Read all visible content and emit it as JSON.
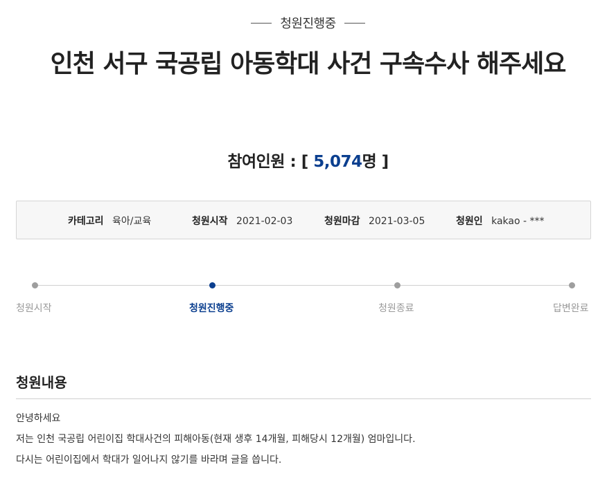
{
  "status": {
    "text": "청원진행중"
  },
  "petition": {
    "title": "인천 서구 국공립 아동학대 사건 구속수사 해주세요"
  },
  "participants": {
    "label": "참여인원 :",
    "open_bracket": "[",
    "count": "5,074",
    "unit": "명",
    "close_bracket": "]"
  },
  "info": {
    "category": {
      "label": "카테고리",
      "value": "육아/교육"
    },
    "start": {
      "label": "청원시작",
      "value": "2021-02-03"
    },
    "end": {
      "label": "청원마감",
      "value": "2021-03-05"
    },
    "author": {
      "label": "청원인",
      "value": "kakao - ***"
    }
  },
  "progress": {
    "current_step": 1,
    "steps": [
      {
        "label": "청원시작"
      },
      {
        "label": "청원진행중"
      },
      {
        "label": "청원종료"
      },
      {
        "label": "답변완료"
      }
    ]
  },
  "content": {
    "section_title": "청원내용",
    "lines": [
      "안녕하세요",
      "저는 인천 국공립 어린이집 학대사건의 피해아동(현재 생후 14개월, 피해당시 12개월) 엄마입니다.",
      "다시는 어린이집에서 학대가 일어나지 않기를 바라며 글을 씁니다."
    ]
  },
  "colors": {
    "accent": "#0b3f8f",
    "inactive": "#9e9e9e"
  }
}
